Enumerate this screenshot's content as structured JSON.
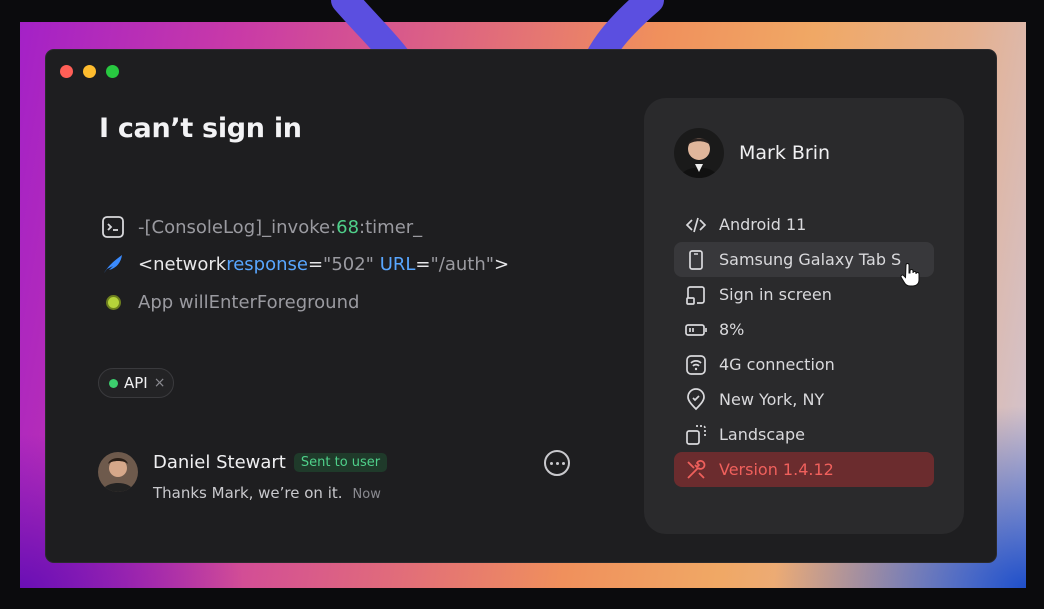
{
  "issue": {
    "title": "I can’t sign in"
  },
  "logs": [
    {
      "icon": "terminal-icon",
      "prefix": "-[ConsoleLog]_invoke:",
      "number": "68",
      "suffix": ":timer_"
    },
    {
      "icon": "feather-icon",
      "open": "<network ",
      "attr1": "response",
      "eq1": "=",
      "val1": "\"502\"",
      "attr2": "URL",
      "eq2": "=",
      "val2": "\"/auth\"",
      "close": ">"
    },
    {
      "icon": "status-dot-icon",
      "text": "App willEnterForeground"
    }
  ],
  "tag": {
    "label": "API",
    "remove": "×"
  },
  "comment": {
    "author": "Daniel Stewart",
    "badge": "Sent to user",
    "text": "Thanks Mark, we’re on it.",
    "time": "Now"
  },
  "user": {
    "name": "Mark Brin",
    "properties": [
      {
        "icon": "code-icon",
        "label": "Android 11"
      },
      {
        "icon": "tablet-icon",
        "label": "Samsung Galaxy Tab S"
      },
      {
        "icon": "screen-icon",
        "label": "Sign in screen"
      },
      {
        "icon": "battery-icon",
        "label": "8%"
      },
      {
        "icon": "wifi-icon",
        "label": "4G connection"
      },
      {
        "icon": "location-pin-icon",
        "label": "New York, NY"
      },
      {
        "icon": "rotate-landscape-icon",
        "label": "Landscape"
      },
      {
        "icon": "tools-icon",
        "label": "Version 1.4.12"
      }
    ]
  },
  "colors": {
    "accent_green": "#4fd08a",
    "accent_blue": "#58a6ff",
    "error_red": "#f0605c",
    "swoosh": "#5b4fe0"
  }
}
